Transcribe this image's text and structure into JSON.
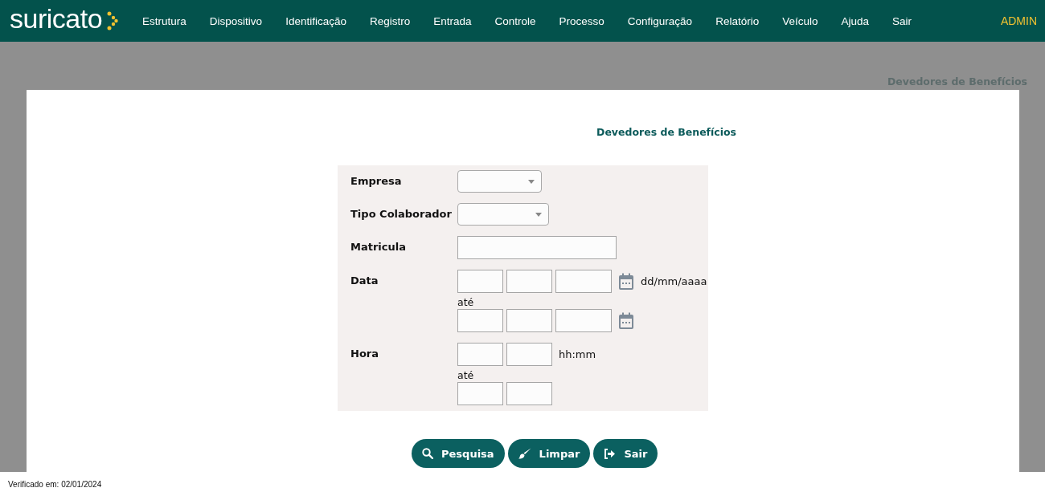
{
  "header": {
    "logo": "suricato",
    "menu": [
      "Estrutura",
      "Dispositivo",
      "Identificação",
      "Registro",
      "Entrada",
      "Controle",
      "Processo",
      "Configuração",
      "Relatório",
      "Veículo",
      "Ajuda",
      "Sair"
    ],
    "user": "ADMIN"
  },
  "breadcrumb": "Devedores de Benefícios",
  "form": {
    "title": "Devedores de Benefícios",
    "fields": [
      {
        "kind": "select",
        "label": "Empresa"
      },
      {
        "kind": "select",
        "label": "Tipo Colaborador"
      },
      {
        "kind": "text",
        "label": "Matricula"
      },
      {
        "kind": "date",
        "label": "Data",
        "format": "dd/mm/aaaa",
        "separator": "até"
      },
      {
        "kind": "time",
        "label": "Hora",
        "format": "hh:mm",
        "separator": "até"
      }
    ],
    "buttons": [
      {
        "kind": "search",
        "label": "Pesquisa"
      },
      {
        "kind": "clear",
        "label": "Limpar"
      },
      {
        "kind": "exit",
        "label": "Sair"
      }
    ]
  },
  "footer": "Verificado em: 02/01/2024"
}
